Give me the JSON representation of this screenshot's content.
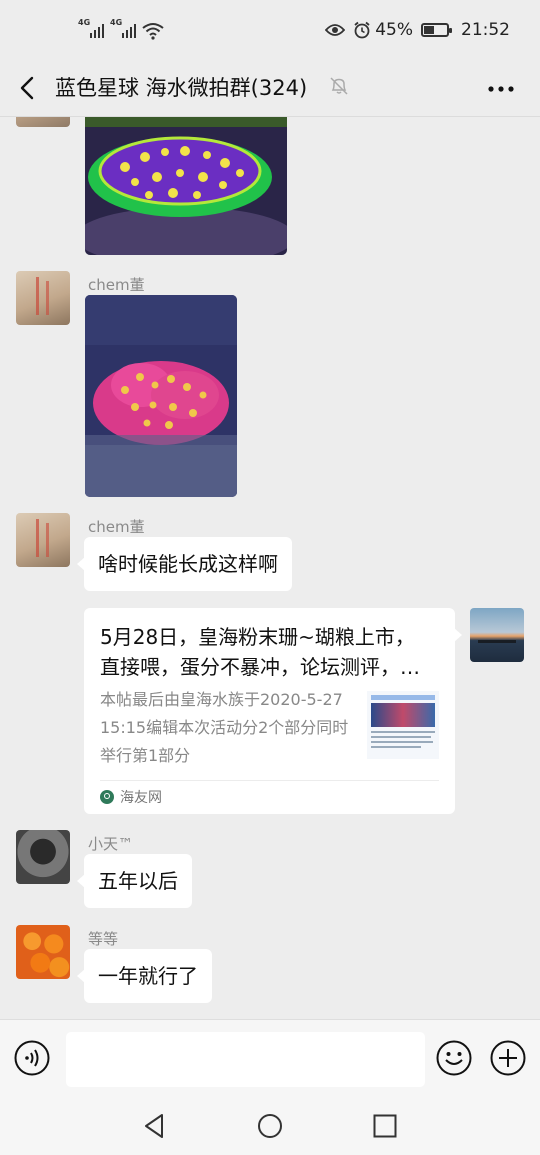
{
  "status_bar": {
    "signal1_label": "4G",
    "signal2_label": "4G",
    "battery_text": "45%",
    "battery_level": 0.45,
    "time": "21:52"
  },
  "header": {
    "title": "蓝色星球 海水微拍群(324)"
  },
  "messages": {
    "m2_sender": "chem董",
    "m3_sender": "chem董",
    "m3_text": "啥时候能长成这样啊",
    "link_card": {
      "title": "5月28日，皇海粉末珊~瑚粮上市，直接喂，蛋分不暴冲，论坛测评，赠送满额免单",
      "desc": "本帖最后由皇海水族于2020-5-2715:15编辑本次活动分2个部分同时举行第1部分",
      "source": "海友网"
    },
    "m5_sender": "小天™",
    "m5_text": "五年以后",
    "m6_sender": "等等",
    "m6_text": "一年就行了"
  },
  "input": {
    "placeholder": ""
  },
  "icons": {
    "back": "back-arrow-icon",
    "mute": "mute-bell-icon",
    "more": "more-dots-icon",
    "voice": "voice-icon",
    "emoji": "emoji-icon",
    "plus": "plus-icon"
  }
}
